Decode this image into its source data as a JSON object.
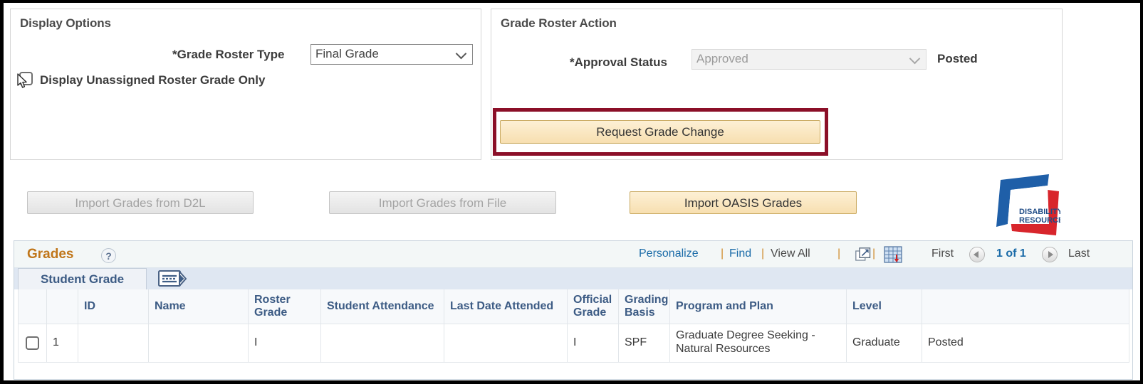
{
  "display_options": {
    "title": "Display Options",
    "grade_roster_type_label": "*Grade Roster Type",
    "grade_roster_type_value": "Final Grade",
    "grade_roster_type_options": [
      "Final Grade"
    ],
    "display_unassigned_label": "Display Unassigned Roster Grade Only",
    "display_unassigned_checked": false
  },
  "roster_action": {
    "title": "Grade Roster Action",
    "approval_status_label": "*Approval Status",
    "approval_status_value": "Approved",
    "approval_status_options": [
      "Approved"
    ],
    "posted_label": "Posted",
    "request_grade_change_label": "Request Grade Change",
    "highlight_color": "#8b0f28"
  },
  "import_buttons": {
    "d2l_label": "Import Grades from D2L",
    "file_label": "Import Grades from File",
    "oasis_label": "Import OASIS Grades"
  },
  "logo": {
    "line1": "DISABILITY",
    "line2": "RESOURCES",
    "blue": "#1f5fa8",
    "red": "#d8262c"
  },
  "grades": {
    "title": "Grades",
    "help_glyph": "?",
    "toolbar": {
      "personalize": "Personalize",
      "find": "Find",
      "view_all": "View All",
      "separator": "|",
      "first": "First",
      "page_indicator": "1 of 1",
      "last": "Last"
    },
    "tabs": [
      {
        "label": "Student Grade",
        "active": true
      }
    ],
    "columns": [
      "",
      "",
      "ID",
      "Name",
      "Roster Grade",
      "Student Attendance",
      "Last Date Attended",
      "Official Grade",
      "Grading Basis",
      "Program and Plan",
      "Level",
      ""
    ],
    "rows": [
      {
        "checkbox": false,
        "index": "1",
        "id": "",
        "name": "",
        "redacted": true,
        "roster_grade": "I",
        "student_attendance": "",
        "last_date_attended": "",
        "official_grade": "I",
        "grading_basis": "SPF",
        "program_and_plan": "Graduate Degree Seeking - Natural Resources",
        "level": "Graduate",
        "status": "Posted"
      }
    ]
  }
}
